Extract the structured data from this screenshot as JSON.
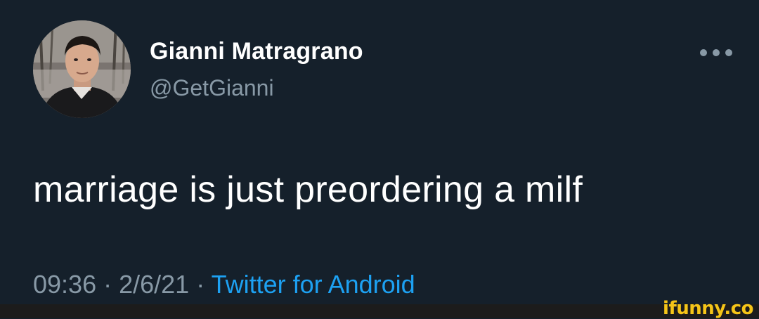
{
  "tweet": {
    "display_name": "Gianni Matragrano",
    "handle": "@GetGianni",
    "text": "marriage is just preordering a milf",
    "time": "09:36",
    "separator": "·",
    "date": "2/6/21",
    "source": "Twitter for Android"
  },
  "icons": {
    "avatar": "profile-photo",
    "more": "more-options-icon"
  },
  "watermark": "ifunny.co",
  "colors": {
    "background": "#15202b",
    "primary_text": "#ffffff",
    "secondary_text": "#8899a6",
    "link": "#1da1f2",
    "watermark": "#f5c518"
  }
}
